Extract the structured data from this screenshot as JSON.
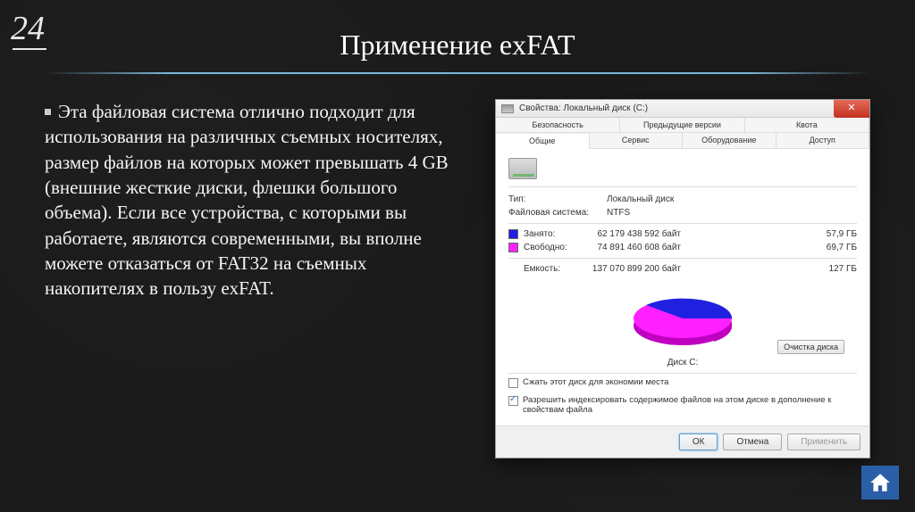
{
  "slide_number": "24",
  "title": "Применение exFAT",
  "body_text": "Эта файловая система отлично подходит для использования на различных съемных носителях, размер файлов на которых может превышать 4 GB (внешние жесткие диски, флешки большого объема). Если все устройства, с которыми вы работаете, являются современными, вы вполне можете отказаться от FAT32 на съемных накопителях в пользу exFAT.",
  "dialog": {
    "title": "Свойства: Локальный диск (C:)",
    "tabs_top": [
      "Безопасность",
      "Предыдущие версии",
      "Квота"
    ],
    "tabs_bottom": [
      "Общие",
      "Сервис",
      "Оборудование",
      "Доступ"
    ],
    "type_label": "Тип:",
    "type_value": "Локальный диск",
    "fs_label": "Файловая система:",
    "fs_value": "NTFS",
    "used_label": "Занято:",
    "used_bytes": "62 179 438 592 байт",
    "used_gb": "57,9 ГБ",
    "free_label": "Свободно:",
    "free_bytes": "74 891 460 608 байт",
    "free_gb": "69,7 ГБ",
    "capacity_label": "Емкость:",
    "capacity_bytes": "137 070 899 200 байт",
    "capacity_gb": "127 ГБ",
    "disk_label": "Диск C:",
    "clean_button": "Очистка диска",
    "compress_label": "Сжать этот диск для экономии места",
    "index_label": "Разрешить индексировать содержимое файлов на этом диске в дополнение к свойствам файла",
    "ok": "ОК",
    "cancel": "Отмена",
    "apply": "Применить"
  },
  "chart_data": {
    "type": "pie",
    "title": "Диск C:",
    "series": [
      {
        "name": "Занято",
        "value": 62179438592,
        "display": "57,9 ГБ",
        "color": "#2020e0"
      },
      {
        "name": "Свободно",
        "value": 74891460608,
        "display": "69,7 ГБ",
        "color": "#ff20ff"
      }
    ],
    "total": {
      "name": "Емкость",
      "value": 137070899200,
      "display": "127 ГБ"
    }
  }
}
